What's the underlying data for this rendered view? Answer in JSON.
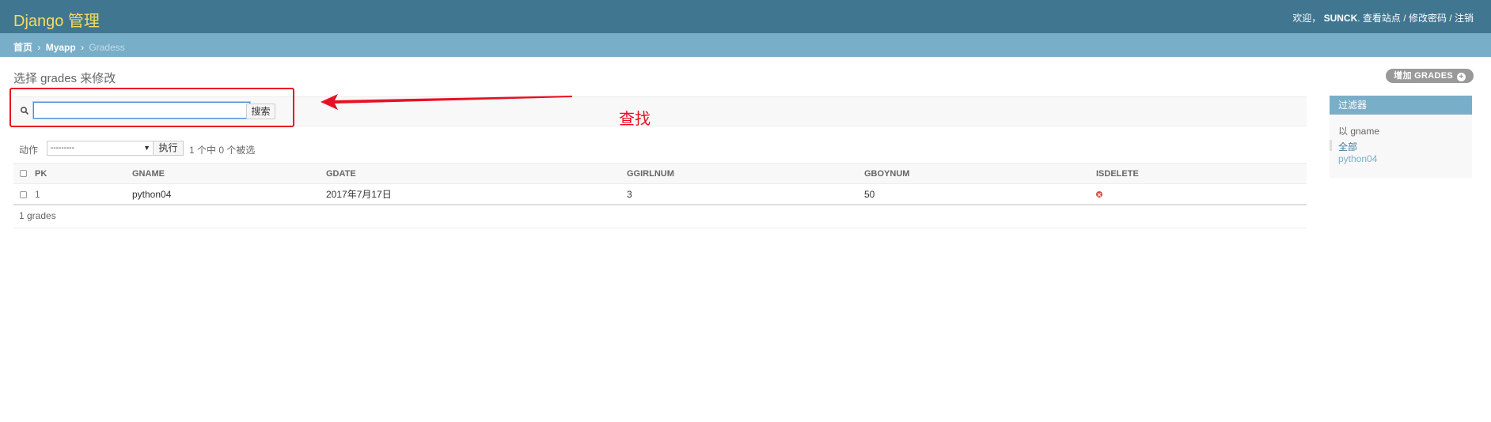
{
  "header": {
    "brand": "Django 管理",
    "welcome": "欢迎，",
    "username": "SUNCK",
    "punct_after_user": ".",
    "view_site": "查看站点",
    "sep": " / ",
    "change_password": "修改密码",
    "logout": "注销"
  },
  "breadcrumbs": {
    "home": "首页",
    "app": "Myapp",
    "current": "Gradess",
    "sep": "›"
  },
  "page": {
    "title": "选择 grades 来修改",
    "add_button": "增加 GRADES"
  },
  "search": {
    "value": "",
    "button": "搜索"
  },
  "annotation": {
    "text": "查找"
  },
  "actions": {
    "label": "动作",
    "selected": "---------",
    "go_button": "执行",
    "counter": "1 个中 0 个被选"
  },
  "table": {
    "columns": [
      "PK",
      "GNAME",
      "GDATE",
      "GGIRLNUM",
      "GBOYNUM",
      "ISDELETE"
    ],
    "rows": [
      {
        "pk": "1",
        "gname": "python04",
        "gdate": "2017年7月17日",
        "ggirlnum": "3",
        "gboynum": "50",
        "isdelete": false
      }
    ]
  },
  "paginator": {
    "text": "1 grades"
  },
  "filter": {
    "heading": "过滤器",
    "by": "以 gname",
    "options": [
      "全部",
      "python04"
    ]
  },
  "colors": {
    "header": "#417690",
    "breadcrumbs": "#79aec8",
    "brand": "#f5dd5d",
    "annotation": "#e81123"
  }
}
